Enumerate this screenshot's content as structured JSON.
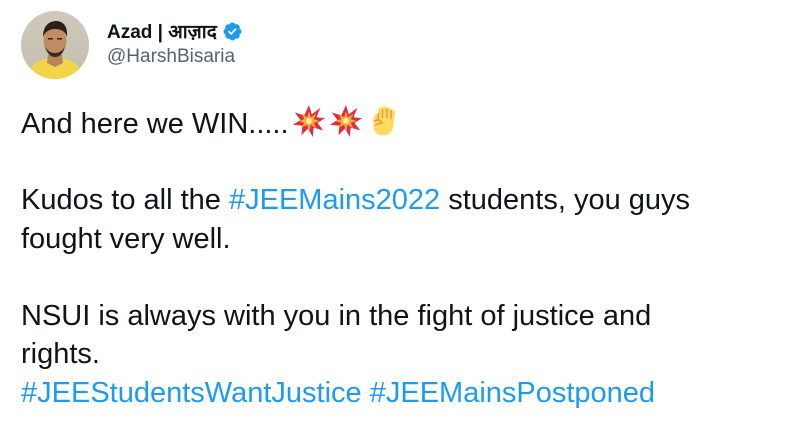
{
  "user": {
    "display_name": "Azad | आज़ाद",
    "handle": "@HarshBisaria",
    "verified": true,
    "avatar_icon": "profile-photo"
  },
  "tweet": {
    "line1_text": "And here we WIN.....",
    "line1_emojis": [
      "collision-emoji",
      "collision-emoji",
      "raised-fist-emoji"
    ],
    "para2_prefix": "Kudos to all the ",
    "para2_hashtag": "#JEEMains2022",
    "para2_suffix": " students, you guys",
    "para2_line2": "fought very well.",
    "para3_line1": "NSUI is always with you in the fight of justice and",
    "para3_line2": "rights.",
    "hashtag_a": "#JEEStudentsWantJustice",
    "hashtag_b": "#JEEMainsPostponed"
  },
  "colors": {
    "text": "#0f1419",
    "secondary": "#536471",
    "link": "#1d9bf0",
    "verified": "#1d9bf0"
  }
}
